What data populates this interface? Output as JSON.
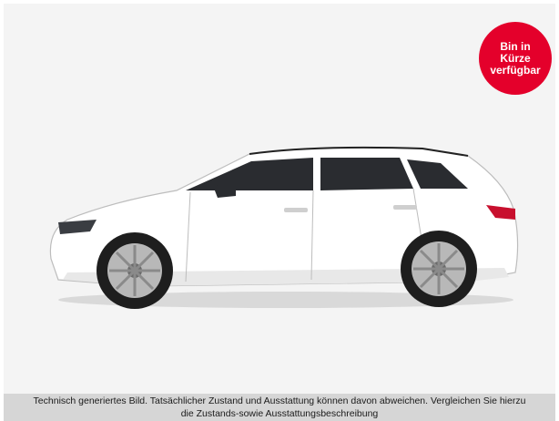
{
  "badge": {
    "lines": [
      "Bin in",
      "Kürze",
      "verfügbar"
    ],
    "color": "#e4002b"
  },
  "image": {
    "subject": "car-icon"
  },
  "caption": {
    "line1": "Technisch generiertes Bild. Tatsächlicher Zustand und Ausstattung können davon abweichen. Vergleichen Sie hierzu",
    "line2": "die Zustands-sowie Ausstattungsbeschreibung"
  }
}
